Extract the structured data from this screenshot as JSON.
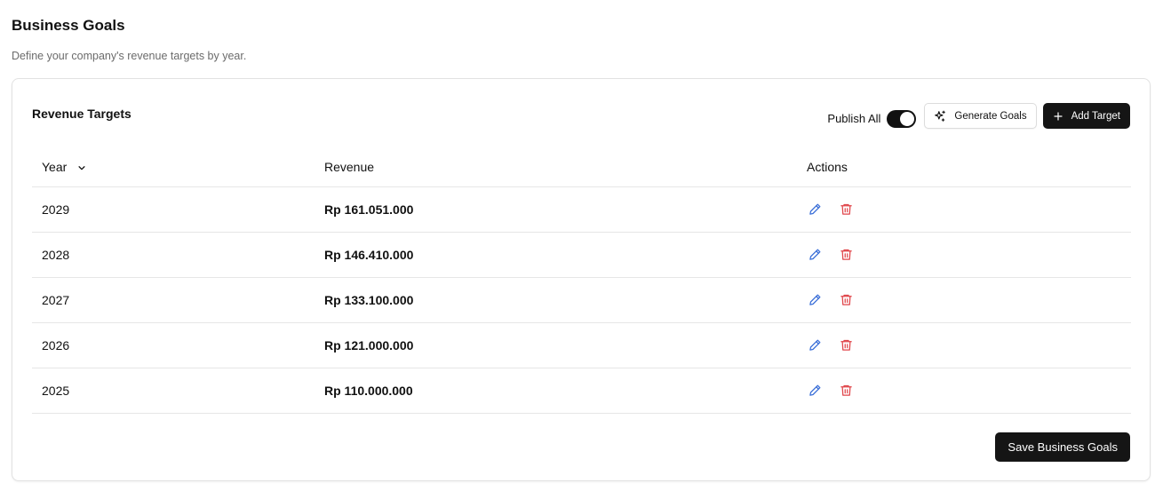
{
  "page": {
    "title": "Business Goals",
    "subtitle": "Define your company's revenue targets by year."
  },
  "card": {
    "title": "Revenue Targets",
    "publish_label": "Publish All",
    "publish_enabled": true,
    "generate_label": "Generate Goals",
    "add_label": "Add Target",
    "save_label": "Save Business Goals"
  },
  "table": {
    "headers": {
      "year": "Year",
      "revenue": "Revenue",
      "actions": "Actions"
    },
    "rows": [
      {
        "year": "2029",
        "revenue": "Rp 161.051.000"
      },
      {
        "year": "2028",
        "revenue": "Rp 146.410.000"
      },
      {
        "year": "2027",
        "revenue": "Rp 133.100.000"
      },
      {
        "year": "2026",
        "revenue": "Rp 121.000.000"
      },
      {
        "year": "2025",
        "revenue": "Rp 110.000.000"
      }
    ]
  },
  "icons": {
    "sort": "chevron-down-icon",
    "generate": "sparkles-icon",
    "add": "plus-icon",
    "edit": "pencil-icon",
    "delete": "trash-icon"
  },
  "colors": {
    "primary": "#151515",
    "edit_icon": "#3b6fd8",
    "delete_icon": "#e0454a",
    "border": "#e2e2e2",
    "muted_text": "#6b6b6b"
  }
}
